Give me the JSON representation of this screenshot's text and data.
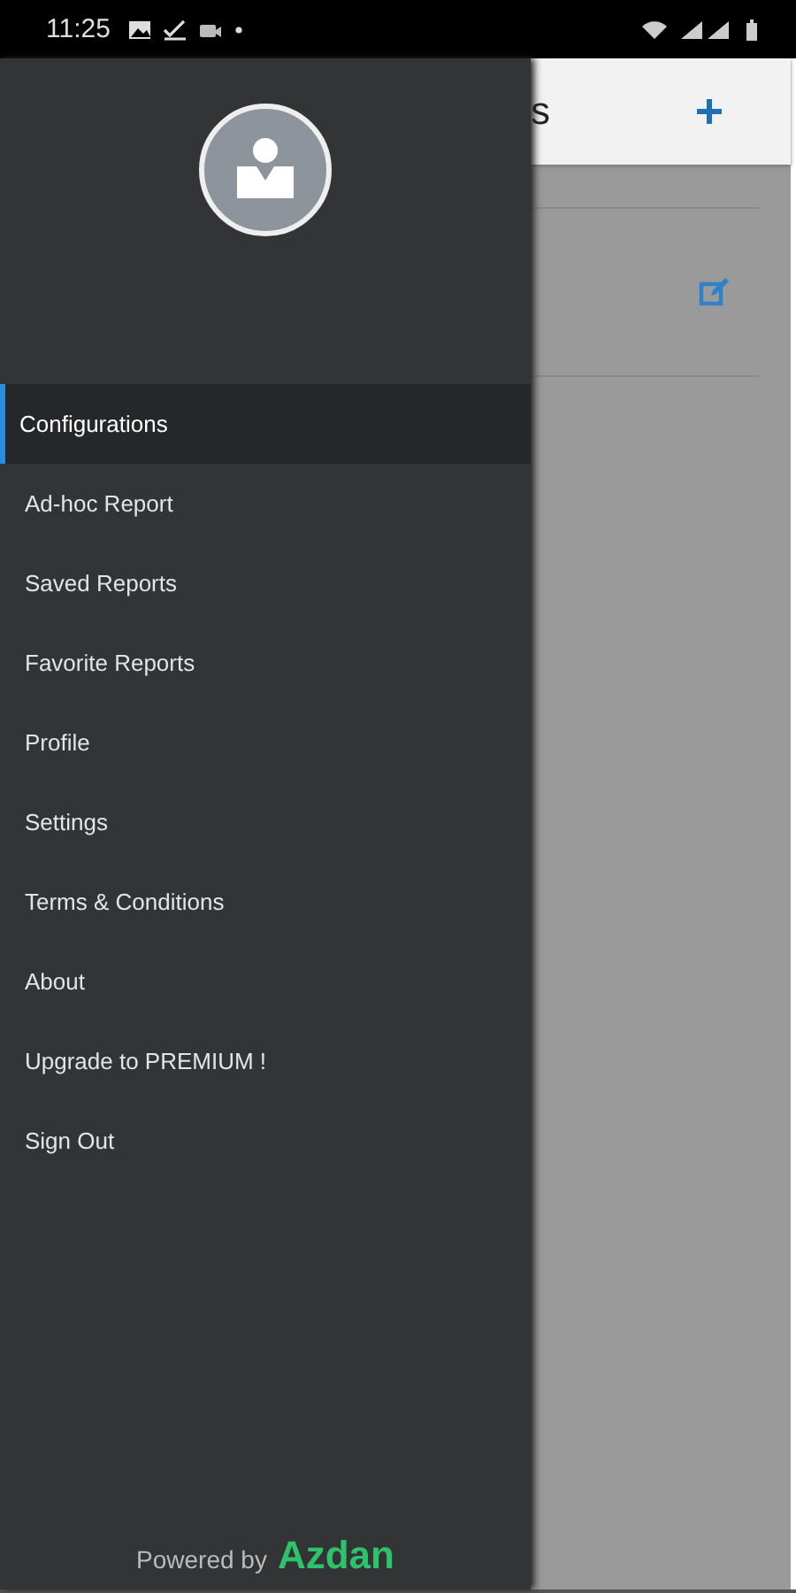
{
  "status_bar": {
    "time": "11:25"
  },
  "header": {
    "title": "s"
  },
  "drawer": {
    "items": [
      {
        "label": "Configurations",
        "selected": true
      },
      {
        "label": "Ad-hoc Report",
        "selected": false
      },
      {
        "label": "Saved Reports",
        "selected": false
      },
      {
        "label": "Favorite Reports",
        "selected": false
      },
      {
        "label": "Profile",
        "selected": false
      },
      {
        "label": "Settings",
        "selected": false
      },
      {
        "label": "Terms & Conditions",
        "selected": false
      },
      {
        "label": "About",
        "selected": false
      },
      {
        "label": "Upgrade to PREMIUM !",
        "selected": false
      },
      {
        "label": "Sign Out",
        "selected": false
      }
    ],
    "footer": {
      "prefix": "Powered by",
      "brand": "Azdan"
    }
  }
}
